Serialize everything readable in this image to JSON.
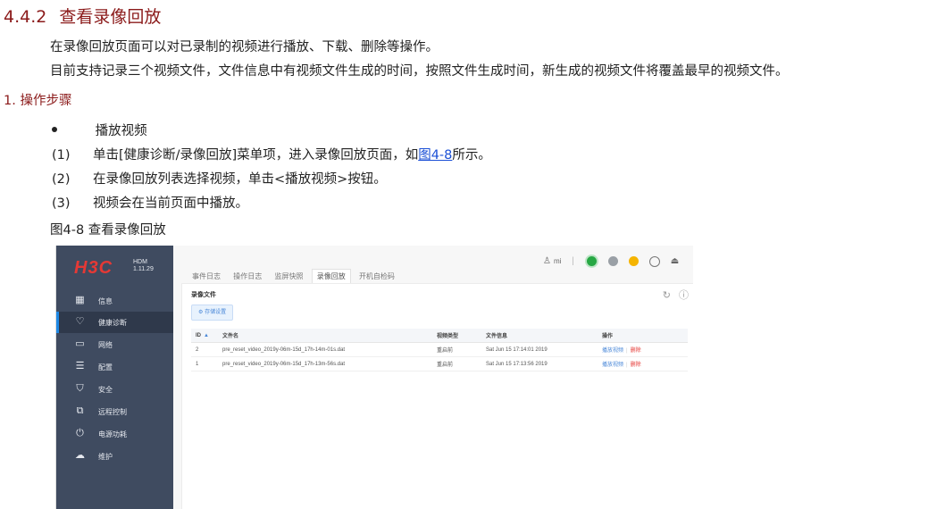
{
  "heading": {
    "number": "4.4.2",
    "title": "查看录像回放"
  },
  "paragraphs": [
    "在录像回放页面可以对已录制的视频进行播放、下载、删除等操作。",
    "目前支持记录三个视频文件，文件信息中有视频文件生成的时间，按照文件生成时间，新生成的视频文件将覆盖最早的视频文件。"
  ],
  "subheading": "1. 操作步骤",
  "bullet": "播放视频",
  "steps": [
    {
      "num": "(1)",
      "before": "单击[健康诊断/录像回放]菜单项，进入录像回放页面，如",
      "link": "图4-8",
      "after": "所示。"
    },
    {
      "num": "(2)",
      "text": "在录像回放列表选择视频，单击<播放视频>按钮。"
    },
    {
      "num": "(3)",
      "text": "视频会在当前页面中播放。"
    }
  ],
  "figure_caption": "图4-8 查看录像回放",
  "screenshot": {
    "logo": "H3C",
    "product": "HDM",
    "version": "1.11.29",
    "nav": [
      {
        "label": "信息",
        "icon": "grid-icon",
        "active": false
      },
      {
        "label": "健康诊断",
        "icon": "heart-icon",
        "active": true
      },
      {
        "label": "网络",
        "icon": "network-icon",
        "active": false
      },
      {
        "label": "配置",
        "icon": "sliders-icon",
        "active": false
      },
      {
        "label": "安全",
        "icon": "shield-icon",
        "active": false
      },
      {
        "label": "远程控制",
        "icon": "remote-icon",
        "active": false
      },
      {
        "label": "电源功耗",
        "icon": "power-icon",
        "active": false
      },
      {
        "label": "维护",
        "icon": "cloud-icon",
        "active": false
      }
    ],
    "tabs": [
      "事件日志",
      "操作日志",
      "监屏快照",
      "录像回放",
      "开机自检码"
    ],
    "active_tab": "录像回放",
    "user": "mi",
    "panel_title": "录像文件",
    "storage_button": "存储设置",
    "table": {
      "headers": [
        "ID",
        "文件名",
        "视频类型",
        "文件信息",
        "操作"
      ],
      "rows": [
        {
          "id": "2",
          "name": "pre_reset_video_2019y-06m-15d_17h-14m-01s.dat",
          "type": "重启前",
          "info": "Sat Jun 15 17:14:01 2019",
          "play": "播放视频",
          "delete": "删除"
        },
        {
          "id": "1",
          "name": "pre_reset_video_2019y-06m-15d_17h-13m-56s.dat",
          "type": "重启前",
          "info": "Sat Jun 15 17:13:56 2019",
          "play": "播放视频",
          "delete": "删除"
        }
      ]
    },
    "colors": {
      "sidebar": "#3f4b60",
      "accent": "#1e88e5",
      "brand": "#e53935",
      "heading": "#8b1a1a"
    }
  }
}
